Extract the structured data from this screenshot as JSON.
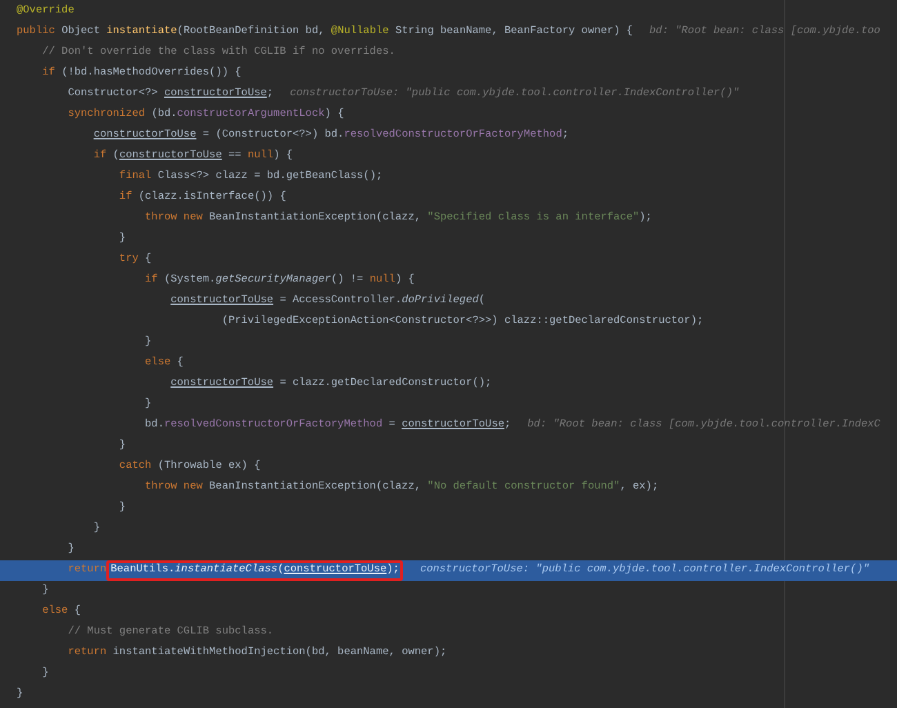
{
  "editor": {
    "lines": [
      {
        "selected": false,
        "tokens": [
          {
            "kind": "annotation",
            "text": "@Override"
          }
        ]
      },
      {
        "selected": false,
        "tokens": [
          {
            "kind": "keyword",
            "text": "public"
          },
          {
            "kind": "plain",
            "text": " Object "
          },
          {
            "kind": "declaration",
            "text": "instantiate"
          },
          {
            "kind": "plain",
            "text": "(RootBeanDefinition bd, "
          },
          {
            "kind": "annotation",
            "text": "@Nullable"
          },
          {
            "kind": "plain",
            "text": " String beanName, BeanFactory owner) {"
          }
        ],
        "hint": "bd: \"Root bean: class [com.ybjde.too"
      },
      {
        "selected": false,
        "tokens": [
          {
            "kind": "comment",
            "text": "    // Don't override the class with CGLIB if no overrides."
          }
        ]
      },
      {
        "selected": false,
        "tokens": [
          {
            "kind": "keyword",
            "text": "    if"
          },
          {
            "kind": "plain",
            "text": " (!bd.hasMethodOverrides()) {"
          }
        ]
      },
      {
        "selected": false,
        "tokens": [
          {
            "kind": "plain",
            "text": "        Constructor<?> "
          },
          {
            "kind": "local",
            "text": "constructorToUse"
          },
          {
            "kind": "plain",
            "text": ";"
          }
        ],
        "hint": "constructorToUse: \"public com.ybjde.tool.controller.IndexController()\""
      },
      {
        "selected": false,
        "tokens": [
          {
            "kind": "keyword",
            "text": "        synchronized"
          },
          {
            "kind": "plain",
            "text": " (bd."
          },
          {
            "kind": "field",
            "text": "constructorArgumentLock"
          },
          {
            "kind": "plain",
            "text": ") {"
          }
        ]
      },
      {
        "selected": false,
        "tokens": [
          {
            "kind": "local",
            "text": "            constructorToUse"
          },
          {
            "kind": "plain",
            "text": " = (Constructor<?>) bd."
          },
          {
            "kind": "field",
            "text": "resolvedConstructorOrFactoryMethod"
          },
          {
            "kind": "plain",
            "text": ";"
          }
        ]
      },
      {
        "selected": false,
        "tokens": [
          {
            "kind": "keyword",
            "text": "            if"
          },
          {
            "kind": "plain",
            "text": " ("
          },
          {
            "kind": "local",
            "text": "constructorToUse"
          },
          {
            "kind": "plain",
            "text": " == "
          },
          {
            "kind": "keyword",
            "text": "null"
          },
          {
            "kind": "plain",
            "text": ") {"
          }
        ]
      },
      {
        "selected": false,
        "tokens": [
          {
            "kind": "keyword",
            "text": "                final"
          },
          {
            "kind": "plain",
            "text": " Class<?> clazz = bd.getBeanClass();"
          }
        ]
      },
      {
        "selected": false,
        "tokens": [
          {
            "kind": "keyword",
            "text": "                if"
          },
          {
            "kind": "plain",
            "text": " (clazz.isInterface()) {"
          }
        ]
      },
      {
        "selected": false,
        "tokens": [
          {
            "kind": "keyword",
            "text": "                    throw new"
          },
          {
            "kind": "plain",
            "text": " BeanInstantiationException(clazz, "
          },
          {
            "kind": "string",
            "text": "\"Specified class is an interface\""
          },
          {
            "kind": "plain",
            "text": ");"
          }
        ]
      },
      {
        "selected": false,
        "tokens": [
          {
            "kind": "plain",
            "text": "                }"
          }
        ]
      },
      {
        "selected": false,
        "tokens": [
          {
            "kind": "keyword",
            "text": "                try"
          },
          {
            "kind": "plain",
            "text": " {"
          }
        ]
      },
      {
        "selected": false,
        "tokens": [
          {
            "kind": "keyword",
            "text": "                    if"
          },
          {
            "kind": "plain",
            "text": " (System."
          },
          {
            "kind": "static_call",
            "text": "getSecurityManager"
          },
          {
            "kind": "plain",
            "text": "() != "
          },
          {
            "kind": "keyword",
            "text": "null"
          },
          {
            "kind": "plain",
            "text": ") {"
          }
        ]
      },
      {
        "selected": false,
        "tokens": [
          {
            "kind": "local",
            "text": "                        constructorToUse"
          },
          {
            "kind": "plain",
            "text": " = AccessController."
          },
          {
            "kind": "static_call",
            "text": "doPrivileged"
          },
          {
            "kind": "plain",
            "text": "("
          }
        ]
      },
      {
        "selected": false,
        "tokens": [
          {
            "kind": "plain",
            "text": "                                (PrivilegedExceptionAction<Constructor<?>>) clazz::getDeclaredConstructor);"
          }
        ]
      },
      {
        "selected": false,
        "tokens": [
          {
            "kind": "plain",
            "text": "                    }"
          }
        ]
      },
      {
        "selected": false,
        "tokens": [
          {
            "kind": "keyword",
            "text": "                    else"
          },
          {
            "kind": "plain",
            "text": " {"
          }
        ]
      },
      {
        "selected": false,
        "tokens": [
          {
            "kind": "local",
            "text": "                        constructorToUse"
          },
          {
            "kind": "plain",
            "text": " = clazz.getDeclaredConstructor();"
          }
        ]
      },
      {
        "selected": false,
        "tokens": [
          {
            "kind": "plain",
            "text": "                    }"
          }
        ]
      },
      {
        "selected": false,
        "tokens": [
          {
            "kind": "plain",
            "text": "                    bd."
          },
          {
            "kind": "field",
            "text": "resolvedConstructorOrFactoryMethod"
          },
          {
            "kind": "plain",
            "text": " = "
          },
          {
            "kind": "local",
            "text": "constructorToUse"
          },
          {
            "kind": "plain",
            "text": ";"
          }
        ],
        "hint": "bd: \"Root bean: class [com.ybjde.tool.controller.IndexC"
      },
      {
        "selected": false,
        "tokens": [
          {
            "kind": "plain",
            "text": "                }"
          }
        ]
      },
      {
        "selected": false,
        "tokens": [
          {
            "kind": "keyword",
            "text": "                catch"
          },
          {
            "kind": "plain",
            "text": " (Throwable ex) {"
          }
        ]
      },
      {
        "selected": false,
        "tokens": [
          {
            "kind": "keyword",
            "text": "                    throw new"
          },
          {
            "kind": "plain",
            "text": " BeanInstantiationException(clazz, "
          },
          {
            "kind": "string",
            "text": "\"No default constructor found\""
          },
          {
            "kind": "plain",
            "text": ", ex);"
          }
        ]
      },
      {
        "selected": false,
        "tokens": [
          {
            "kind": "plain",
            "text": "                }"
          }
        ]
      },
      {
        "selected": false,
        "tokens": [
          {
            "kind": "plain",
            "text": "            }"
          }
        ]
      },
      {
        "selected": false,
        "tokens": [
          {
            "kind": "plain",
            "text": "        }"
          }
        ]
      },
      {
        "selected": true,
        "tokens": [
          {
            "kind": "keyword",
            "text": "        return"
          },
          {
            "kind": "boxed",
            "children": [
              {
                "kind": "plain",
                "text": "BeanUtils."
              },
              {
                "kind": "static_call",
                "text": "instantiateClass"
              },
              {
                "kind": "plain",
                "text": "("
              },
              {
                "kind": "local",
                "text": "constructorToUse"
              },
              {
                "kind": "plain",
                "text": ");"
              }
            ]
          }
        ],
        "hint": "constructorToUse: \"public com.ybjde.tool.controller.IndexController()\""
      },
      {
        "selected": false,
        "tokens": [
          {
            "kind": "plain",
            "text": "    }"
          }
        ]
      },
      {
        "selected": false,
        "tokens": [
          {
            "kind": "keyword",
            "text": "    else"
          },
          {
            "kind": "plain",
            "text": " {"
          }
        ]
      },
      {
        "selected": false,
        "tokens": [
          {
            "kind": "comment",
            "text": "        // Must generate CGLIB subclass."
          }
        ]
      },
      {
        "selected": false,
        "tokens": [
          {
            "kind": "keyword",
            "text": "        return"
          },
          {
            "kind": "plain",
            "text": " instantiateWithMethodInjection(bd, beanName, owner);"
          }
        ]
      },
      {
        "selected": false,
        "tokens": [
          {
            "kind": "plain",
            "text": "    }"
          }
        ]
      },
      {
        "selected": false,
        "tokens": [
          {
            "kind": "plain",
            "text": "}"
          }
        ]
      }
    ]
  }
}
